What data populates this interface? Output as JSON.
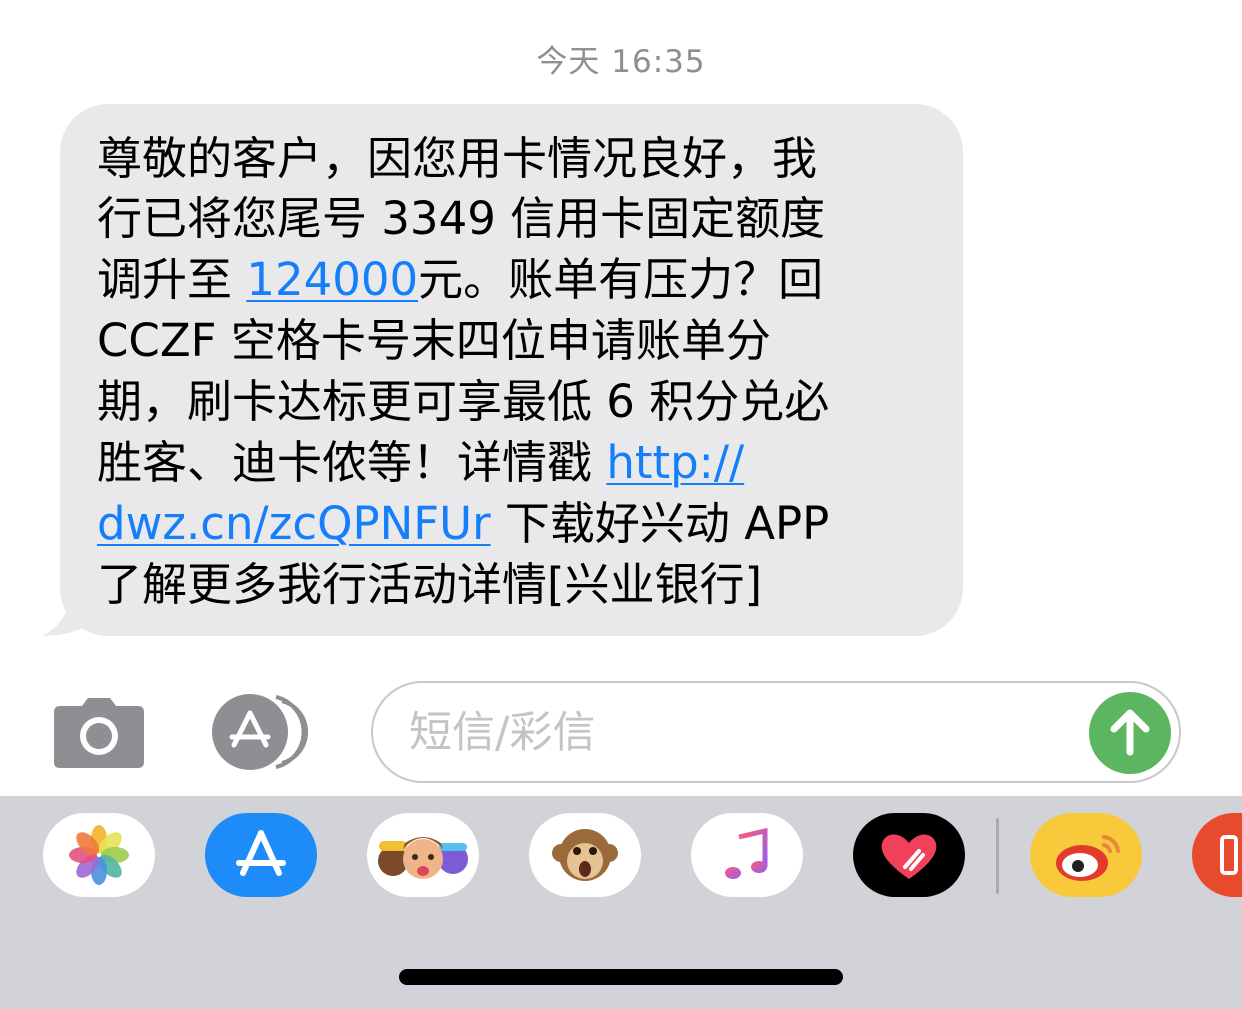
{
  "timestamp": "今天 16:35",
  "message": {
    "line1": "尊敬的客户，因您用卡情况良好，我",
    "line2": "行已将您尾号 3349 信用卡固定额度",
    "line3_before": "调升至 ",
    "line3_link": "124000",
    "line3_after": "元。账单有压力？回",
    "line4": "CCZF 空格卡号末四位申请账单分",
    "line5": "期，刷卡达标更可享最低 6 积分兑必",
    "line6_before": "胜客、迪卡侬等！详情戳 ",
    "line6_link": "http://",
    "line7_link": "dwz.cn/zcQPNFUr",
    "line7_after": " 下载好兴动 APP",
    "line8": "了解更多我行活动详情[兴业银行]"
  },
  "input": {
    "placeholder": "短信/彩信"
  },
  "icons": {
    "camera": "camera-icon",
    "appstore": "appstore-icon",
    "send": "send-arrow-icon"
  },
  "colors": {
    "bubble": "#e9e9eb",
    "link": "#147efb",
    "send": "#5cb65f",
    "drawer": "#d1d3d9"
  },
  "app_drawer": [
    {
      "name": "photos-app-icon"
    },
    {
      "name": "appstore-app-icon"
    },
    {
      "name": "memoji-stickers-icon"
    },
    {
      "name": "animoji-icon"
    },
    {
      "name": "music-app-icon"
    },
    {
      "name": "digital-touch-icon"
    },
    {
      "name": "weibo-app-icon"
    },
    {
      "name": "partial-app-icon"
    }
  ]
}
